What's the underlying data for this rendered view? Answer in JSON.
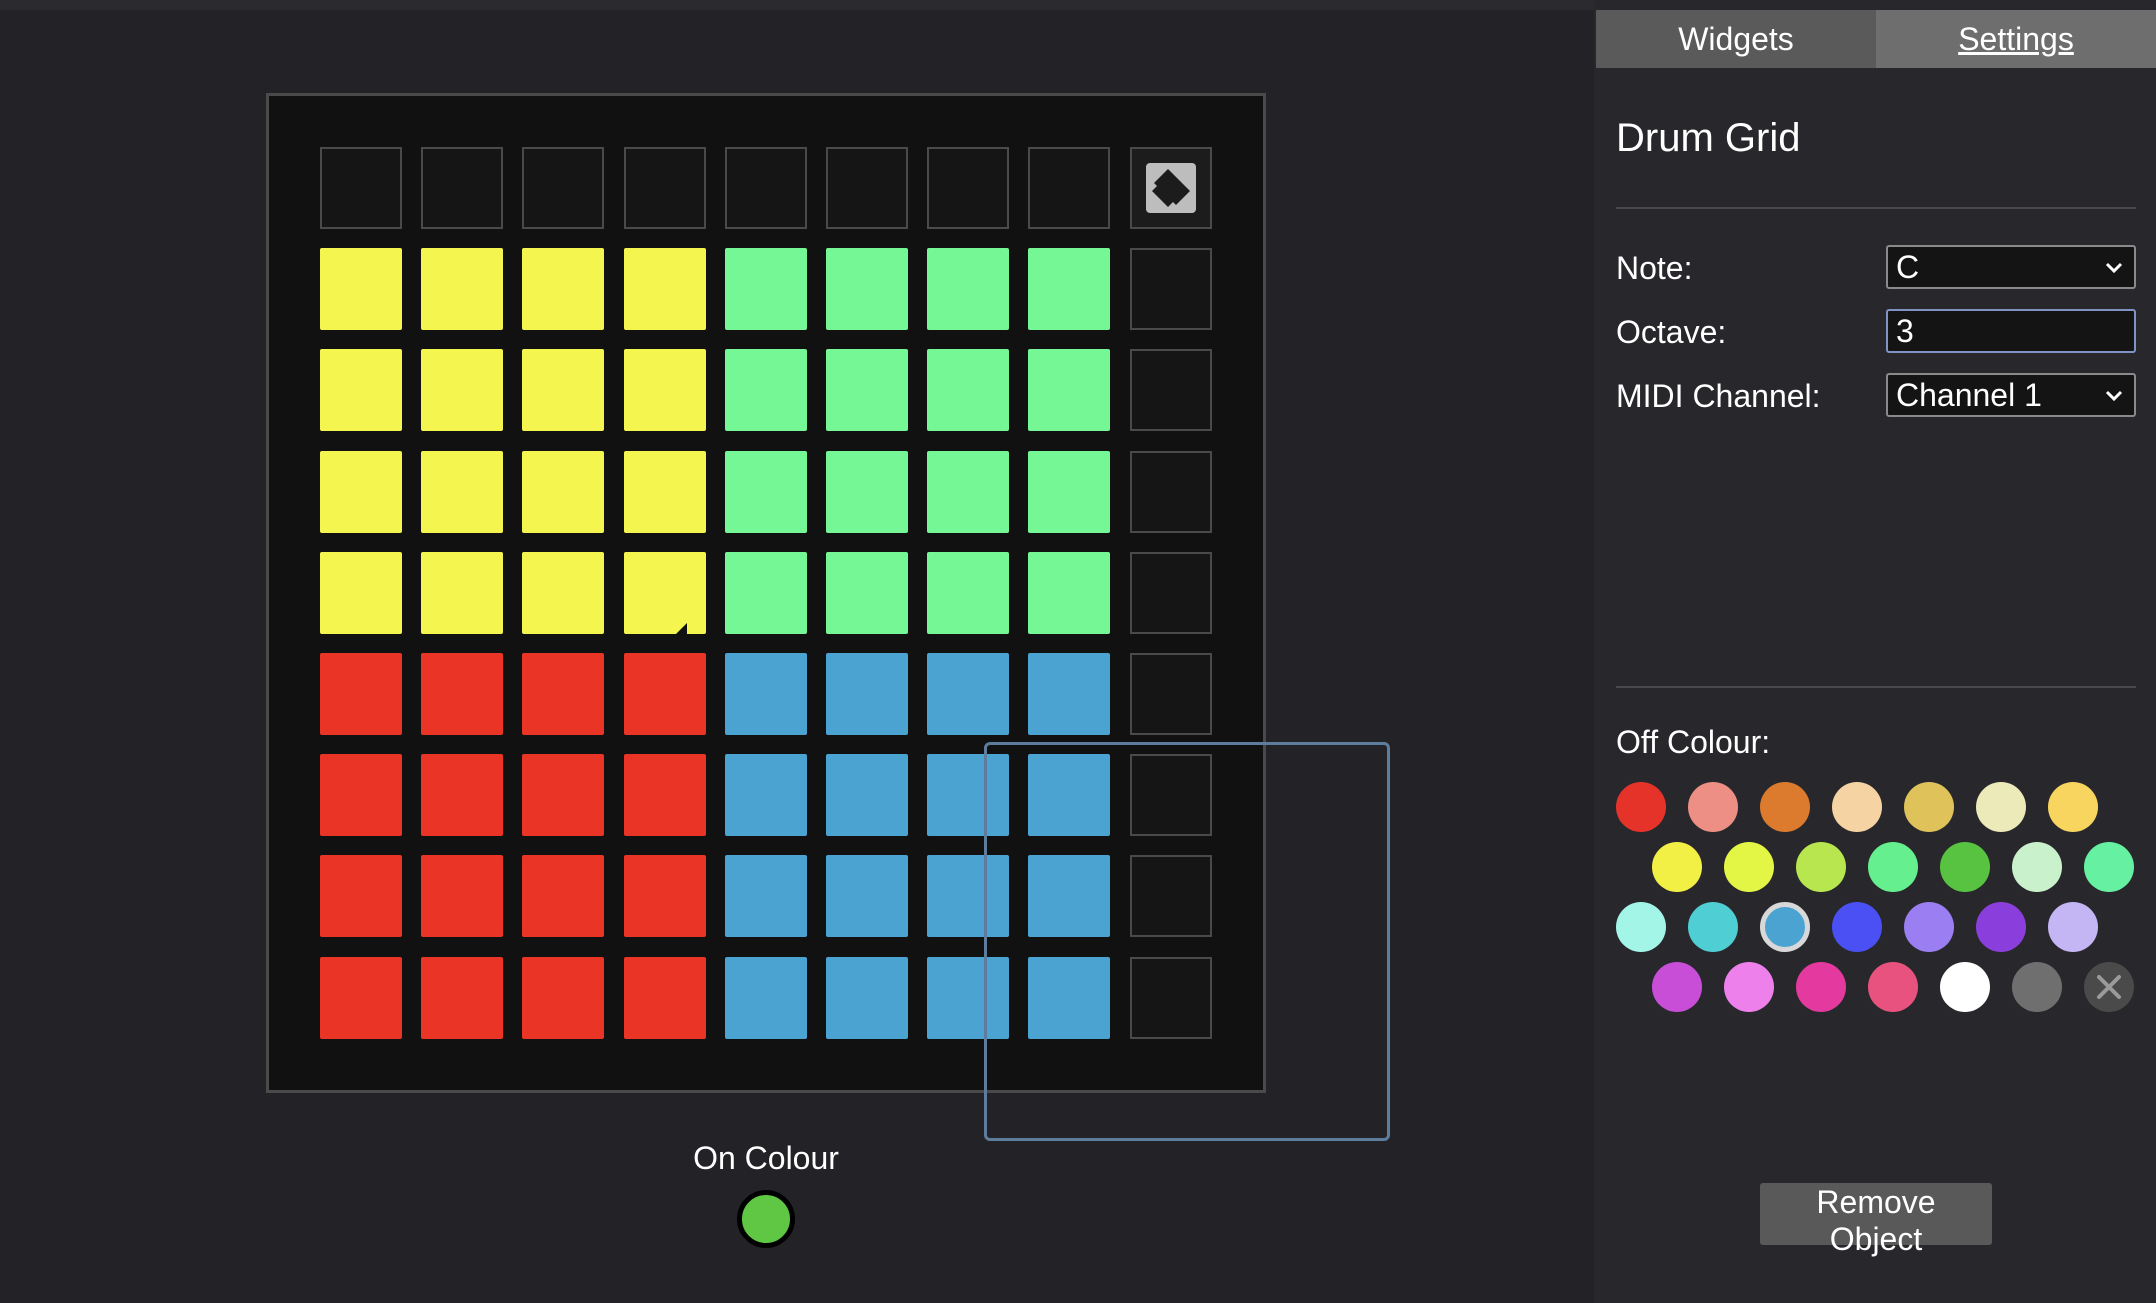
{
  "tabs": {
    "widgets": "Widgets",
    "settings": "Settings"
  },
  "object": {
    "title": "Drum Grid"
  },
  "fields": {
    "note_label": "Note:",
    "note_value": "C",
    "octave_label": "Octave:",
    "octave_value": "3",
    "midi_label": "MIDI Channel:",
    "midi_value": "Channel 1"
  },
  "off_colour": {
    "label": "Off Colour:",
    "selected_index": 16,
    "rows": [
      [
        "#e5332a",
        "#ed8f85",
        "#dc7b2e",
        "#f6d3a3",
        "#dfc35a",
        "#eceab8",
        "#f8d55e"
      ],
      [
        "#f2ef45",
        "#e3f545",
        "#b8e64e",
        "#66ef8e",
        "#58c241",
        "#c9f2cc",
        "#66f0a2"
      ],
      [
        "#a3f5e8",
        "#4fcfd3",
        "#4ba3d1",
        "#4a50f3",
        "#9a7ef2",
        "#8a3fdc",
        "#c4b6f5"
      ],
      [
        "#c84ed8",
        "#ee80ec",
        "#e43a9f",
        "#e8527f",
        "#ffffff",
        "#6f6f6f",
        "clear-icon"
      ]
    ]
  },
  "on_colour": {
    "label": "On Colour",
    "color": "#5fc744"
  },
  "grid": {
    "colors": {
      "yellow": "#f5f550",
      "green": "#75f796",
      "red": "#e93426",
      "blue": "#4aa3d1",
      "empty": "#151515"
    },
    "rows": [
      [
        "empty",
        "empty",
        "empty",
        "empty",
        "empty",
        "empty",
        "empty",
        "empty",
        "logo"
      ],
      [
        "yellow",
        "yellow",
        "yellow",
        "yellow",
        "green",
        "green",
        "green",
        "green",
        "empty"
      ],
      [
        "yellow",
        "yellow",
        "yellow",
        "yellow",
        "green",
        "green",
        "green",
        "green",
        "empty"
      ],
      [
        "yellow",
        "yellow",
        "yellow",
        "yellow",
        "green",
        "green",
        "green",
        "green",
        "empty"
      ],
      [
        "yellow",
        "yellow",
        "yellow",
        "yellow",
        "green",
        "green",
        "green",
        "green",
        "empty"
      ],
      [
        "red",
        "red",
        "red",
        "red",
        "blue",
        "blue",
        "blue",
        "blue",
        "empty"
      ],
      [
        "red",
        "red",
        "red",
        "red",
        "blue",
        "blue",
        "blue",
        "blue",
        "empty"
      ],
      [
        "red",
        "red",
        "red",
        "red",
        "blue",
        "blue",
        "blue",
        "blue",
        "empty"
      ],
      [
        "red",
        "red",
        "red",
        "red",
        "blue",
        "blue",
        "blue",
        "blue",
        "empty"
      ]
    ]
  },
  "buttons": {
    "remove": "Remove Object"
  }
}
